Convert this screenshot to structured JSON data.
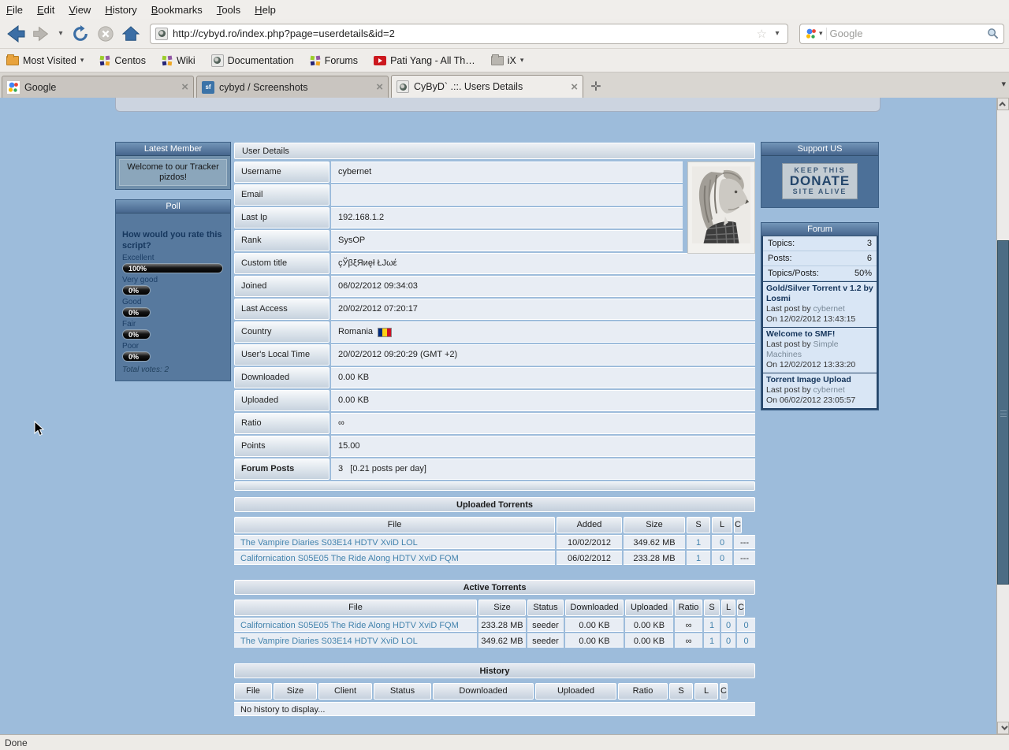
{
  "browser": {
    "menu": [
      "File",
      "Edit",
      "View",
      "History",
      "Bookmarks",
      "Tools",
      "Help"
    ],
    "url": "http://cybyd.ro/index.php?page=userdetails&id=2",
    "search_placeholder": "Google",
    "bookmarks": [
      {
        "label": "Most Visited"
      },
      {
        "label": "Centos"
      },
      {
        "label": "Wiki"
      },
      {
        "label": "Documentation"
      },
      {
        "label": "Forums"
      },
      {
        "label": "Pati Yang - All Th…"
      },
      {
        "label": "iX"
      }
    ],
    "tabs": [
      {
        "title": "Google"
      },
      {
        "title": "cybyd / Screenshots"
      },
      {
        "title": "CyByD` .::. Users Details"
      }
    ],
    "status": "Done"
  },
  "sidebar_left": {
    "latest_member": {
      "title": "Latest Member",
      "message": "Welcome to our Tracker pizdos!"
    },
    "poll": {
      "title": "Poll",
      "question": "How would you rate this script?",
      "options": [
        {
          "label": "Excellent",
          "pct": "100%"
        },
        {
          "label": "Very good",
          "pct": "0%"
        },
        {
          "label": "Good",
          "pct": "0%"
        },
        {
          "label": "Fair",
          "pct": "0%"
        },
        {
          "label": "Poor",
          "pct": "0%"
        }
      ],
      "total": "Total votes: 2"
    }
  },
  "user_details": {
    "title": "User Details",
    "rows": [
      {
        "label": "Username",
        "value": "cybernet"
      },
      {
        "label": "Email",
        "value": ""
      },
      {
        "label": "Last Ip",
        "value": "192.168.1.2"
      },
      {
        "label": "Rank",
        "value": "SysOP"
      },
      {
        "label": "Custom title",
        "value": "çЎβξЯиęł ŁЈωέ"
      },
      {
        "label": "Joined",
        "value": "06/02/2012 09:34:03"
      },
      {
        "label": "Last Access",
        "value": "20/02/2012 07:20:17"
      },
      {
        "label": "Country",
        "value": "Romania"
      },
      {
        "label": "User's Local Time",
        "value": "20/02/2012 09:20:29 (GMT +2)"
      },
      {
        "label": "Downloaded",
        "value": "0.00 KB"
      },
      {
        "label": "Uploaded",
        "value": "0.00 KB"
      },
      {
        "label": "Ratio",
        "value": "∞"
      },
      {
        "label": "Points",
        "value": "15.00"
      },
      {
        "label": "Forum Posts",
        "value": "3   [0.21 posts per day]"
      }
    ]
  },
  "uploaded_torrents": {
    "title": "Uploaded Torrents",
    "headers": [
      "File",
      "Added",
      "Size",
      "S",
      "L",
      "C"
    ],
    "rows": [
      [
        "The Vampire Diaries S03E14 HDTV XviD LOL",
        "10/02/2012",
        "349.62 MB",
        "1",
        "0",
        "---"
      ],
      [
        "Californication S05E05 The Ride Along HDTV XviD FQM",
        "06/02/2012",
        "233.28 MB",
        "1",
        "0",
        "---"
      ]
    ]
  },
  "active_torrents": {
    "title": "Active Torrents",
    "headers": [
      "File",
      "Size",
      "Status",
      "Downloaded",
      "Uploaded",
      "Ratio",
      "S",
      "L",
      "C"
    ],
    "rows": [
      [
        "Californication S05E05 The Ride Along HDTV XviD FQM",
        "233.28 MB",
        "seeder",
        "0.00 KB",
        "0.00 KB",
        "∞",
        "1",
        "0",
        "0"
      ],
      [
        "The Vampire Diaries S03E14 HDTV XviD LOL",
        "349.62 MB",
        "seeder",
        "0.00 KB",
        "0.00 KB",
        "∞",
        "1",
        "0",
        "0"
      ]
    ]
  },
  "history": {
    "title": "History",
    "headers": [
      "File",
      "Size",
      "Client",
      "Status",
      "Downloaded",
      "Uploaded",
      "Ratio",
      "S",
      "L",
      "C"
    ],
    "empty": "No history to display..."
  },
  "sidebar_right": {
    "support": {
      "title": "Support US",
      "donate_line1": "KEEP THIS",
      "donate_line2": "DONATE",
      "donate_line3": "SITE ALIVE"
    },
    "forum": {
      "title": "Forum",
      "stats": [
        {
          "label": "Topics:",
          "value": "3"
        },
        {
          "label": "Posts:",
          "value": "6"
        },
        {
          "label": "Topics/Posts:",
          "value": "50%"
        }
      ],
      "posts": [
        {
          "title": "Gold/Silver Torrent v 1.2 by Losmi",
          "by": "Last post by ",
          "author": "cybernet",
          "on": "On 12/02/2012 13:43:15"
        },
        {
          "title": "Welcome to SMF!",
          "by": "Last post by ",
          "author": "Simple Machines",
          "on": "On 12/02/2012 13:33:20"
        },
        {
          "title": "Torrent Image Upload",
          "by": "Last post by ",
          "author": "cybernet",
          "on": "On 06/02/2012 23:05:57"
        }
      ]
    }
  },
  "colors": {
    "page_bg": "#9dbcdb",
    "box_header_top": "#7396b8",
    "box_header_bottom": "#46658d",
    "link": "#4383ad"
  }
}
